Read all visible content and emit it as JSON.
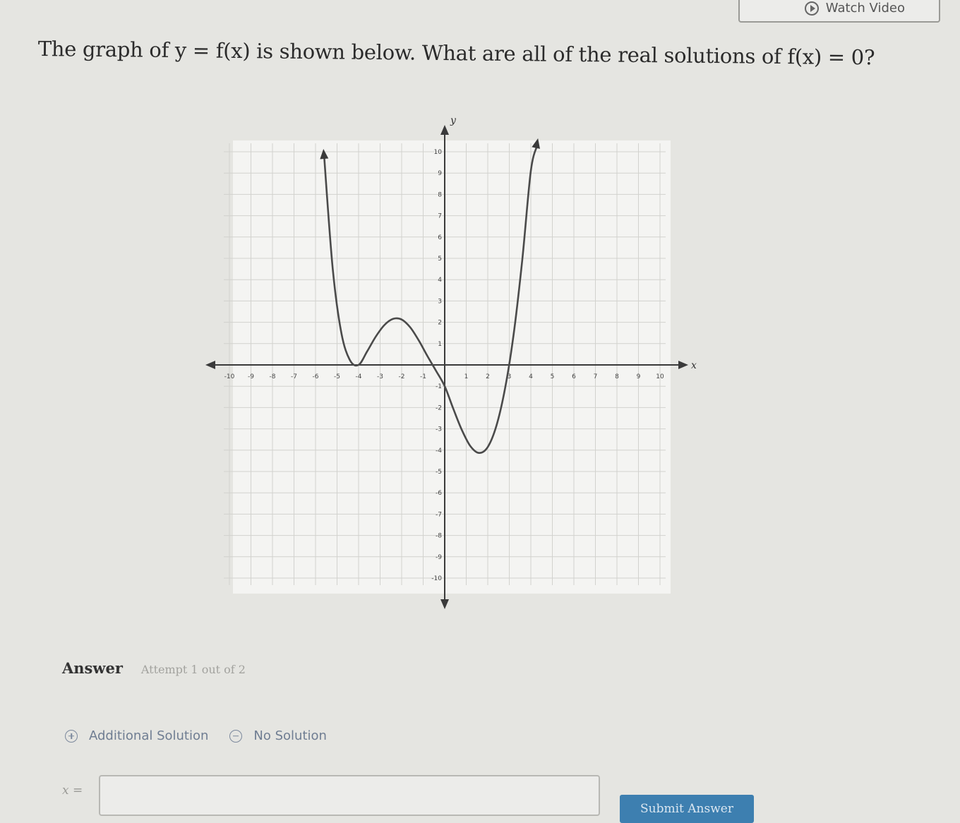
{
  "header": {
    "watch_video_label": "Watch Video"
  },
  "question": {
    "text": "The graph of y = f(x) is shown below. What are all of the real solutions of f(x) = 0?"
  },
  "chart_data": {
    "type": "line",
    "xlabel": "x",
    "ylabel": "y",
    "xlim": [
      -10,
      10
    ],
    "ylim": [
      -10,
      10
    ],
    "x_ticks": [
      -10,
      -9,
      -8,
      -7,
      -6,
      -5,
      -4,
      -3,
      -2,
      -1,
      1,
      2,
      3,
      4,
      5,
      6,
      7,
      8,
      9,
      10
    ],
    "y_ticks": [
      -10,
      -9,
      -8,
      -7,
      -6,
      -5,
      -4,
      -3,
      -2,
      -1,
      1,
      2,
      3,
      4,
      5,
      6,
      7,
      8,
      9,
      10
    ],
    "grid": true,
    "series": [
      {
        "x": [
          -5.6,
          -5.2,
          -4.8,
          -4.4,
          -4.0,
          -3.6,
          -3.2,
          -2.8,
          -2.4,
          -2.0,
          -1.6,
          -1.2,
          -0.8,
          -0.4,
          0.0,
          0.4,
          0.8,
          1.2,
          1.6,
          2.0,
          2.4,
          2.8,
          3.2,
          3.6,
          4.0,
          4.3
        ],
        "y": [
          9.8,
          4.5,
          1.5,
          0.22,
          0.0,
          0.64,
          1.33,
          1.87,
          2.16,
          2.13,
          1.76,
          1.14,
          0.41,
          -0.28,
          -1.0,
          -2.06,
          -3.06,
          -3.82,
          -4.13,
          -3.85,
          -2.86,
          -1.12,
          1.42,
          4.9,
          9.1,
          10.3
        ]
      }
    ]
  },
  "answer": {
    "label": "Answer",
    "attempt": "Attempt 1 out of 2",
    "additional_solution_label": "Additional Solution",
    "no_solution_label": "No Solution",
    "x_prefix": "x =",
    "input_value": "",
    "submit_label": "Submit Answer"
  }
}
